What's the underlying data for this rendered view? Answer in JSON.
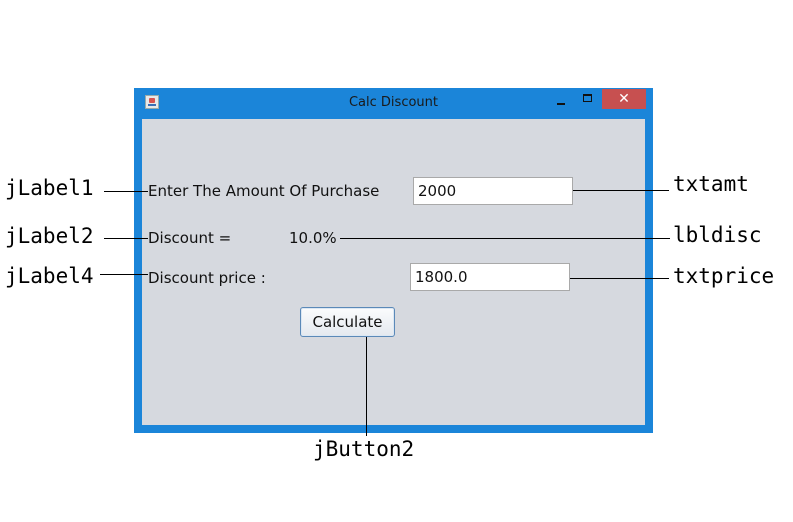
{
  "window": {
    "title": "Calc Discount",
    "close_glyph": "✕"
  },
  "form": {
    "amount_label": "Enter The Amount Of Purchase",
    "amount_value": "2000",
    "discount_label": "Discount =",
    "discount_value": "10.0%",
    "price_label": "Discount price :",
    "price_value": "1800.0",
    "calculate_label": "Calculate"
  },
  "annotations": {
    "jlabel1": "jLabel1",
    "jlabel2": "jLabel2",
    "jlabel4": "jLabel4",
    "txtamt": "txtamt",
    "lbldisc": "lbldisc",
    "txtprice": "txtprice",
    "jbutton2": "jButton2"
  },
  "colors": {
    "window_border": "#1b85d9",
    "client_background": "#d6d9df",
    "close_button": "#c75050"
  },
  "icons": {
    "app": "java-app-icon",
    "minimize": "minimize-icon",
    "maximize": "maximize-icon",
    "close": "close-icon"
  }
}
